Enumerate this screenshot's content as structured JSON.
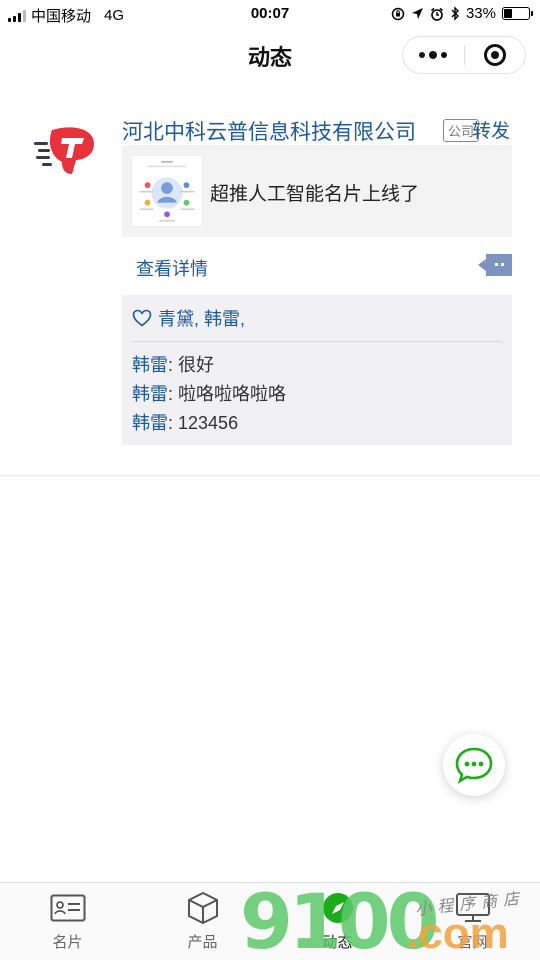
{
  "status_bar": {
    "carrier": "中国移动",
    "network": "4G",
    "time": "00:07",
    "battery": "33%",
    "battery_level": 0.33
  },
  "nav": {
    "title": "动态"
  },
  "post": {
    "company": "河北中科云普信息科技有限公司",
    "company_tag": "公司",
    "forward_label": "转发",
    "share_text": "超推人工智能名片上线了",
    "detail_link": "查看详情",
    "likes": "青黛, 韩雷,",
    "comments": [
      {
        "author": "韩雷",
        "sep": ": ",
        "text": "很好"
      },
      {
        "author": "韩雷",
        "sep": ": ",
        "text": "啦咯啦咯啦咯"
      },
      {
        "author": "韩雷",
        "sep": ": ",
        "text": "123456"
      }
    ]
  },
  "tabs": [
    {
      "label": "名片",
      "icon": "card-icon"
    },
    {
      "label": "产品",
      "icon": "box-icon"
    },
    {
      "label": "动态",
      "icon": "compass-icon",
      "active": true
    },
    {
      "label": "官网",
      "icon": "monitor-icon"
    }
  ],
  "watermark": {
    "big": "9100",
    "com": ".com",
    "cn": "小程序商店"
  },
  "colors": {
    "link": "#1d5aa0",
    "accent_green": "#1aad19",
    "logo_red": "#e8313a"
  }
}
